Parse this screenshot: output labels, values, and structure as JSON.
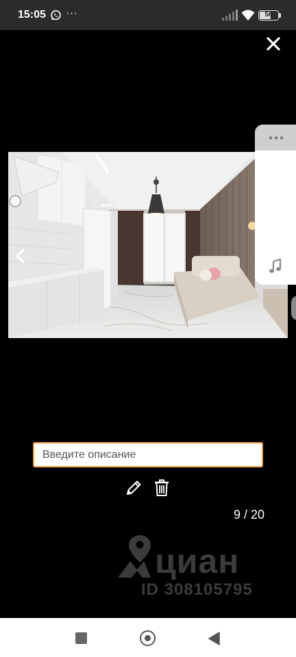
{
  "status_bar": {
    "time": "15:05",
    "more": "···",
    "battery": "56",
    "icons": [
      "whatsapp-icon",
      "signal-icon",
      "wifi-icon",
      "battery-icon"
    ]
  },
  "viewer": {
    "close_icon": "close-icon",
    "prev_icon": "chevron-left-icon",
    "photo_alt": "Кухня-гостиная"
  },
  "side_panel": {
    "icons": [
      "more-dots-icon",
      "music-note-icon"
    ]
  },
  "description": {
    "placeholder": "Введите описание",
    "value": ""
  },
  "actions": {
    "icons": [
      "pencil-icon",
      "trash-icon"
    ]
  },
  "pager": {
    "current": 9,
    "total": 20,
    "label": "9 / 20"
  },
  "watermark": {
    "brand": "циан",
    "id_text": "ID 308105795"
  },
  "nav_bar": {
    "icons": [
      "recents-icon",
      "home-icon",
      "back-icon"
    ]
  },
  "colors": {
    "accent": "#f0a040",
    "background": "#000000",
    "status_bar": "#2b2b2b"
  }
}
